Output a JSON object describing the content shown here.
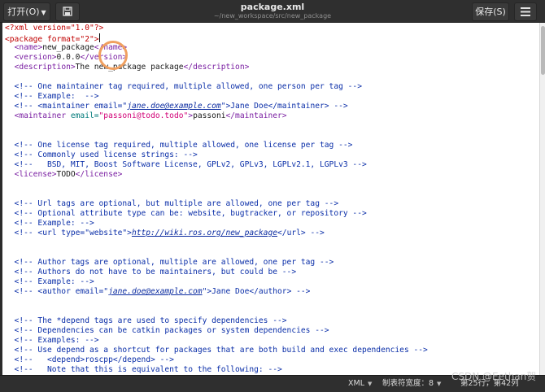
{
  "header": {
    "open_label": "打开(O)",
    "save_label": "保存(S)",
    "title": "package.xml",
    "path": "~/new_workspace/src/new_package",
    "save_icon": "document-save-icon",
    "menu_icon": "hamburger-menu-icon"
  },
  "editor": {
    "lines": [
      [
        {
          "c": "k",
          "t": "<?xml version=\"1.0\"?>"
        }
      ],
      [
        {
          "c": "k",
          "t": "<package format=\"2\">"
        },
        {
          "c": "cursor",
          "t": ""
        }
      ],
      [
        {
          "c": "",
          "t": "  "
        },
        {
          "c": "t",
          "t": "<name>"
        },
        {
          "c": "",
          "t": "new_package"
        },
        {
          "c": "t",
          "t": "</name>"
        }
      ],
      [
        {
          "c": "",
          "t": "  "
        },
        {
          "c": "t",
          "t": "<version>"
        },
        {
          "c": "",
          "t": "0.0.0"
        },
        {
          "c": "t",
          "t": "</version>"
        }
      ],
      [
        {
          "c": "",
          "t": "  "
        },
        {
          "c": "t",
          "t": "<description>"
        },
        {
          "c": "",
          "t": "The new_package package"
        },
        {
          "c": "t",
          "t": "</description>"
        }
      ],
      [],
      [
        {
          "c": "c",
          "t": "  <!-- One maintainer tag required, multiple allowed, one person per tag -->"
        }
      ],
      [
        {
          "c": "c",
          "t": "  <!-- Example:  -->"
        }
      ],
      [
        {
          "c": "c",
          "t": "  <!-- <maintainer email=\""
        },
        {
          "c": "u",
          "t": "jane.doe@example.com"
        },
        {
          "c": "c",
          "t": "\">Jane Doe</maintainer> -->"
        }
      ],
      [
        {
          "c": "",
          "t": "  "
        },
        {
          "c": "t",
          "t": "<maintainer "
        },
        {
          "c": "a",
          "t": "email="
        },
        {
          "c": "s",
          "t": "\"passoni@todo.todo\""
        },
        {
          "c": "t",
          "t": ">"
        },
        {
          "c": "",
          "t": "passoni"
        },
        {
          "c": "t",
          "t": "</maintainer>"
        }
      ],
      [],
      [],
      [
        {
          "c": "c",
          "t": "  <!-- One license tag required, multiple allowed, one license per tag -->"
        }
      ],
      [
        {
          "c": "c",
          "t": "  <!-- Commonly used license strings: -->"
        }
      ],
      [
        {
          "c": "c",
          "t": "  <!--   BSD, MIT, Boost Software License, GPLv2, GPLv3, LGPLv2.1, LGPLv3 -->"
        }
      ],
      [
        {
          "c": "",
          "t": "  "
        },
        {
          "c": "t",
          "t": "<license>"
        },
        {
          "c": "",
          "t": "TODO"
        },
        {
          "c": "t",
          "t": "</license>"
        }
      ],
      [],
      [],
      [
        {
          "c": "c",
          "t": "  <!-- Url tags are optional, but multiple are allowed, one per tag -->"
        }
      ],
      [
        {
          "c": "c",
          "t": "  <!-- Optional attribute type can be: website, bugtracker, or repository -->"
        }
      ],
      [
        {
          "c": "c",
          "t": "  <!-- Example: -->"
        }
      ],
      [
        {
          "c": "c",
          "t": "  <!-- <url type=\"website\">"
        },
        {
          "c": "u",
          "t": "http://wiki.ros.org/new_package"
        },
        {
          "c": "c",
          "t": "</url> -->"
        }
      ],
      [],
      [],
      [
        {
          "c": "c",
          "t": "  <!-- Author tags are optional, multiple are allowed, one per tag -->"
        }
      ],
      [
        {
          "c": "c",
          "t": "  <!-- Authors do not have to be maintainers, but could be -->"
        }
      ],
      [
        {
          "c": "c",
          "t": "  <!-- Example: -->"
        }
      ],
      [
        {
          "c": "c",
          "t": "  <!-- <author email=\""
        },
        {
          "c": "u",
          "t": "jane.doe@example.com"
        },
        {
          "c": "c",
          "t": "\">Jane Doe</author> -->"
        }
      ],
      [],
      [],
      [
        {
          "c": "c",
          "t": "  <!-- The *depend tags are used to specify dependencies -->"
        }
      ],
      [
        {
          "c": "c",
          "t": "  <!-- Dependencies can be catkin packages or system dependencies -->"
        }
      ],
      [
        {
          "c": "c",
          "t": "  <!-- Examples: -->"
        }
      ],
      [
        {
          "c": "c",
          "t": "  <!-- Use depend as a shortcut for packages that are both build and exec dependencies -->"
        }
      ],
      [
        {
          "c": "c",
          "t": "  <!--   <depend>roscpp</depend> -->"
        }
      ],
      [
        {
          "c": "c",
          "t": "  <!--   Note that this is equivalent to the following: -->"
        }
      ]
    ]
  },
  "statusbar": {
    "language": "XML",
    "tab_width": "制表符宽度：8",
    "position": "第25行，第42列"
  },
  "watermark": "CSDN @Eethan贺"
}
